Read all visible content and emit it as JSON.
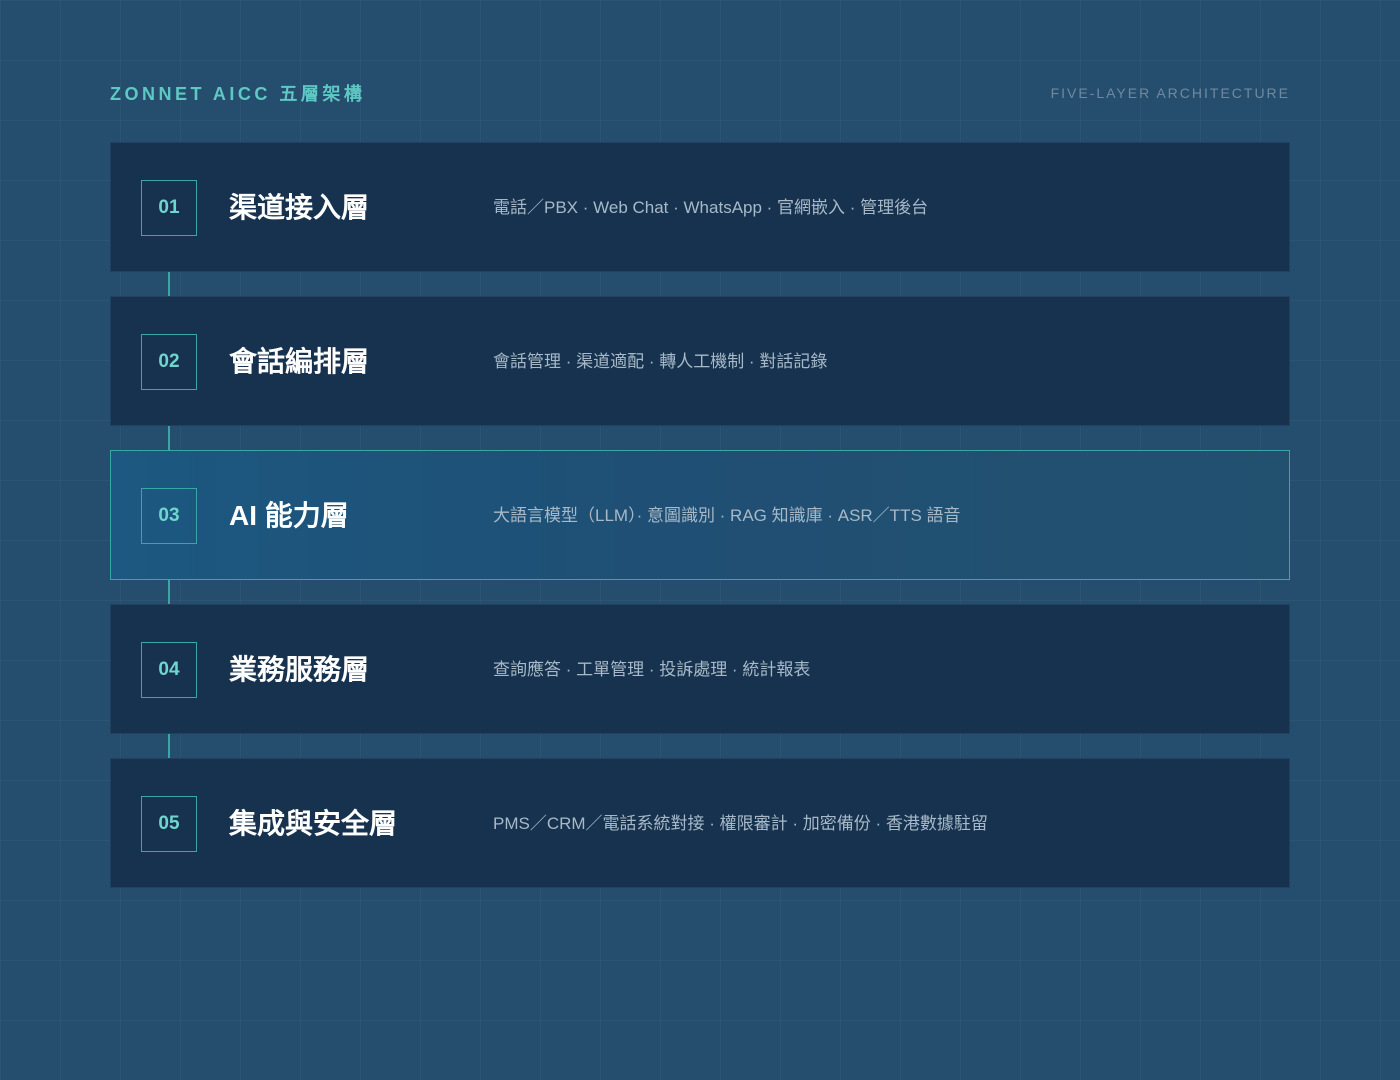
{
  "header": {
    "title": "ZONNET AICC 五層架構",
    "subtitle": "FIVE-LAYER ARCHITECTURE"
  },
  "layers": [
    {
      "num": "01",
      "name": "渠道接入層",
      "desc": "電話／PBX · Web Chat · WhatsApp · 官網嵌入 · 管理後台",
      "highlight": false
    },
    {
      "num": "02",
      "name": "會話編排層",
      "desc": "會話管理 · 渠道適配 · 轉人工機制 · 對話記錄",
      "highlight": false
    },
    {
      "num": "03",
      "name": "AI 能力層",
      "desc": "大語言模型（LLM）· 意圖識別 · RAG 知識庫 · ASR／TTS 語音",
      "highlight": true
    },
    {
      "num": "04",
      "name": "業務服務層",
      "desc": "查詢應答 · 工單管理 · 投訴處理 · 統計報表",
      "highlight": false
    },
    {
      "num": "05",
      "name": "集成與安全層",
      "desc": "PMS／CRM／電話系統對接 · 權限審計 · 加密備份 · 香港數據駐留",
      "highlight": false
    }
  ],
  "colors": {
    "background": "#254d6d",
    "card": "#17324e",
    "accent": "#3aa6a6",
    "title_accent": "#5ec9c4"
  }
}
